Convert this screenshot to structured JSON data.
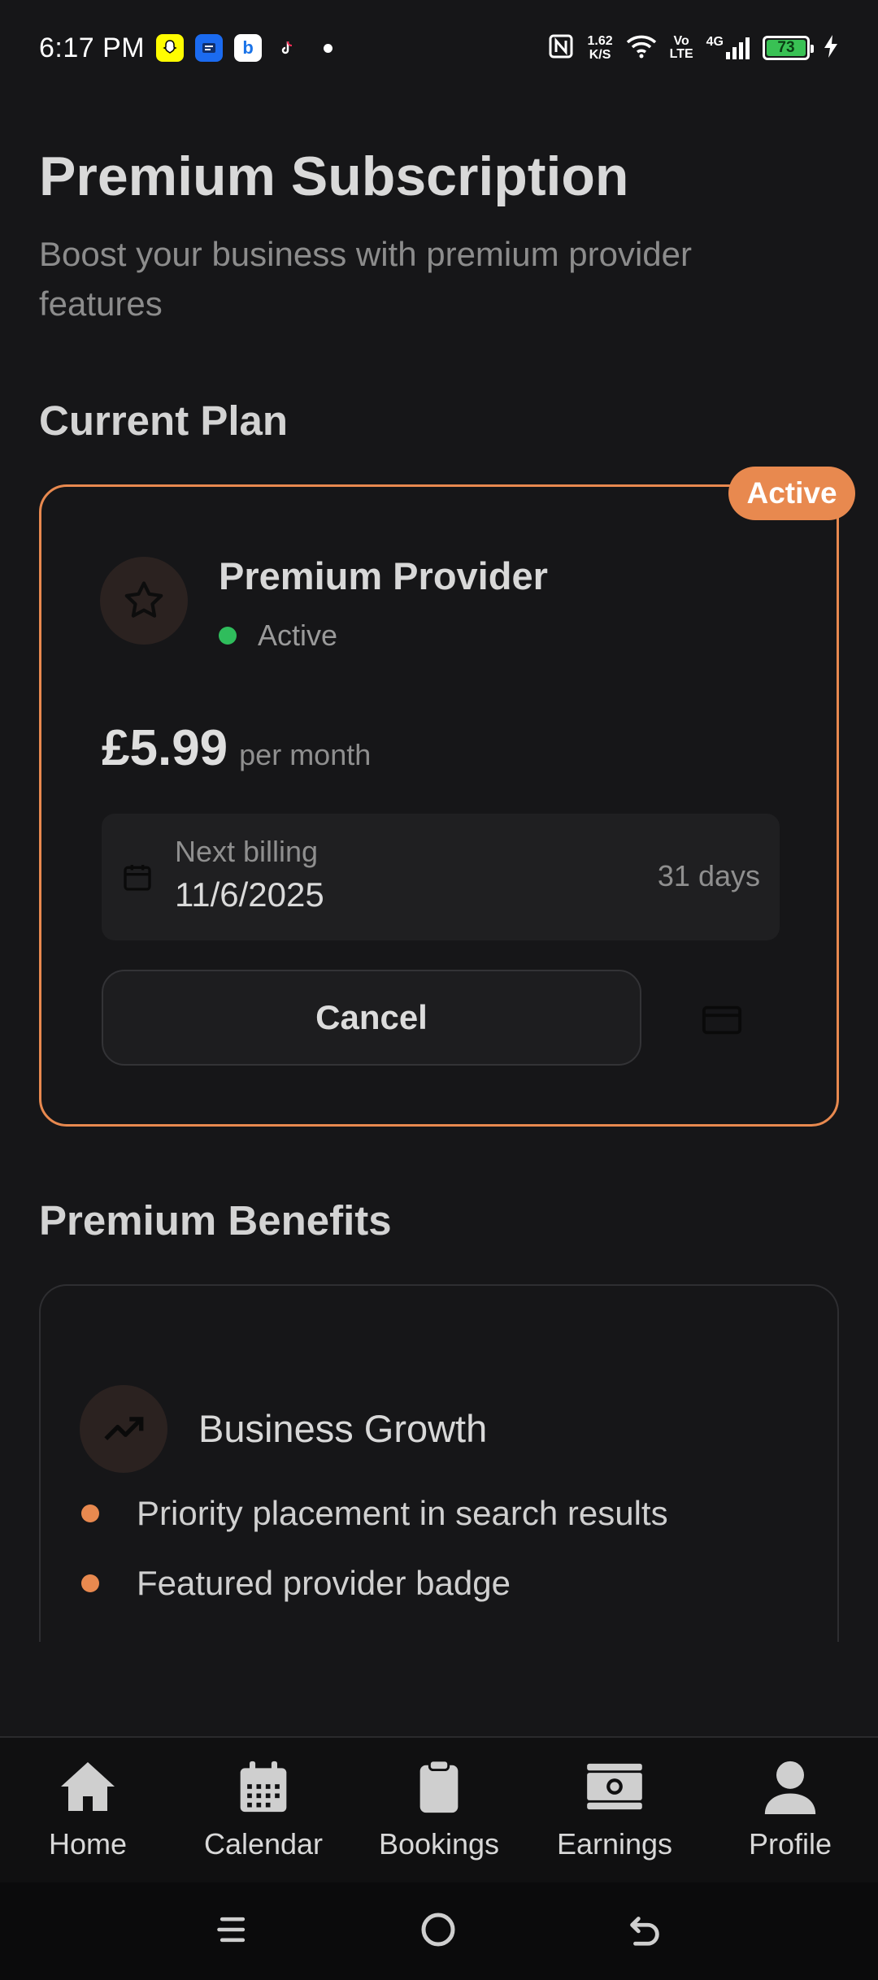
{
  "status_bar": {
    "time": "6:17 PM",
    "speed_value": "1.62",
    "speed_unit": "K/S",
    "volte_top": "Vo",
    "volte_bottom": "LTE",
    "network": "4G",
    "battery": "73",
    "icons": [
      "snapchat-icon",
      "messages-icon",
      "bing-icon",
      "tiktok-icon",
      "nfc-icon",
      "wifi-icon",
      "signal-icon",
      "battery-icon",
      "charging-icon"
    ]
  },
  "header": {
    "title": "Premium Subscription",
    "subtitle": "Boost your business with premium provider features"
  },
  "current_plan": {
    "section_title": "Current Plan",
    "badge": "Active",
    "plan_name": "Premium Provider",
    "status": "Active",
    "price": "£5.99",
    "period": "per month",
    "billing_label": "Next billing",
    "billing_date": "11/6/2025",
    "billing_days": "31 days",
    "cancel_label": "Cancel",
    "accent_color": "#e8894f",
    "status_color": "#2fbd5c"
  },
  "benefits": {
    "section_title": "Premium Benefits",
    "group_title": "Business Growth",
    "items": [
      "Priority placement in search results",
      "Featured provider badge"
    ]
  },
  "nav": {
    "items": [
      {
        "label": "Home",
        "icon": "home-icon"
      },
      {
        "label": "Calendar",
        "icon": "calendar-icon"
      },
      {
        "label": "Bookings",
        "icon": "clipboard-icon"
      },
      {
        "label": "Earnings",
        "icon": "money-icon"
      },
      {
        "label": "Profile",
        "icon": "person-icon"
      }
    ]
  },
  "system_nav": [
    "menu-icon",
    "home-circle-icon",
    "back-icon"
  ]
}
